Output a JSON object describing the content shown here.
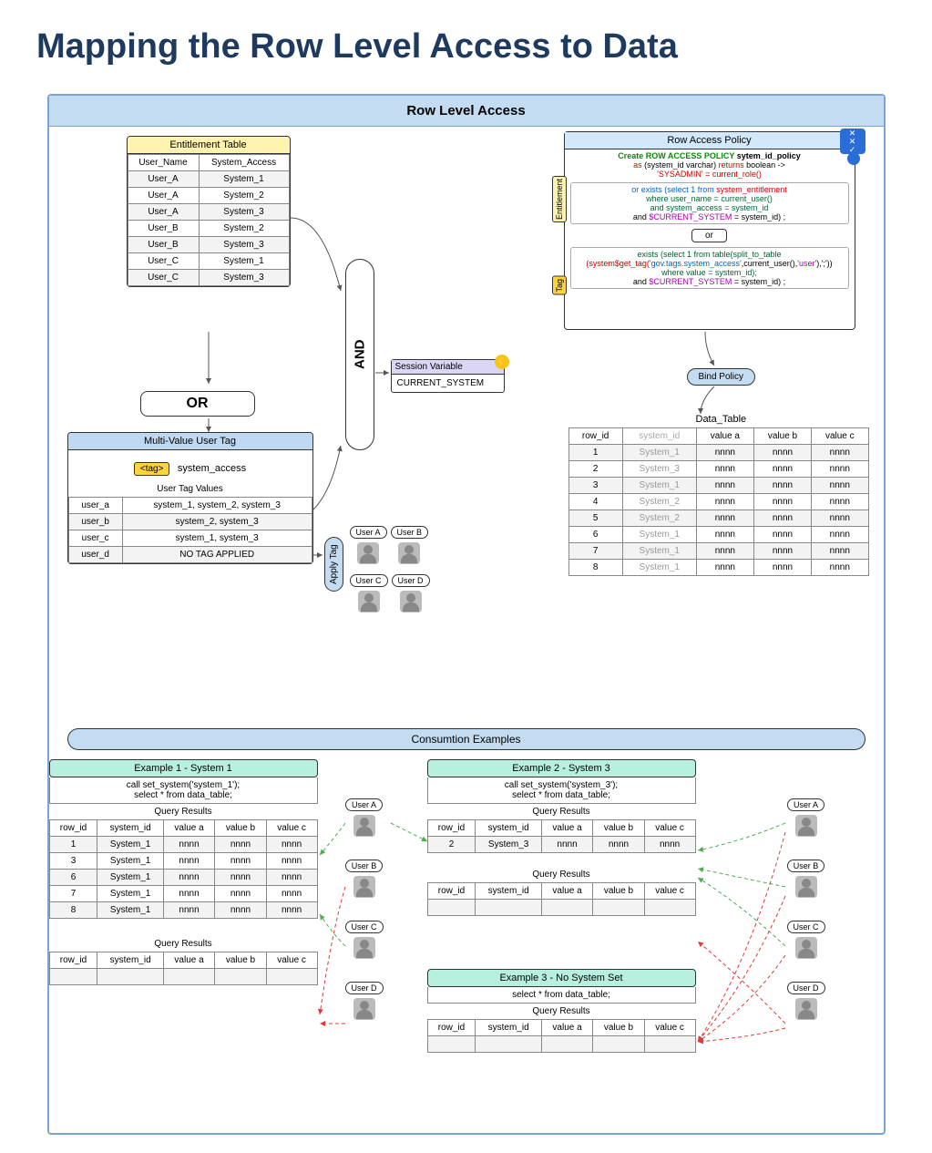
{
  "page_title": "Mapping the Row Level Access to Data",
  "frame_title": "Row Level Access",
  "entitlement": {
    "title": "Entitlement Table",
    "cols": [
      "User_Name",
      "System_Access"
    ],
    "rows": [
      [
        "User_A",
        "System_1"
      ],
      [
        "User_A",
        "System_2"
      ],
      [
        "User_A",
        "System_3"
      ],
      [
        "User_B",
        "System_2"
      ],
      [
        "User_B",
        "System_3"
      ],
      [
        "User_C",
        "System_1"
      ],
      [
        "User_C",
        "System_3"
      ]
    ]
  },
  "or_label": "OR",
  "and_label": "AND",
  "multi_tag": {
    "title": "Multi-Value User Tag",
    "chip": "<tag>",
    "chip_value": "system_access",
    "values_title": "User Tag Values",
    "rows": [
      [
        "user_a",
        "system_1, system_2, system_3"
      ],
      [
        "user_b",
        "system_2, system_3"
      ],
      [
        "user_c",
        "system_1, system_3"
      ],
      [
        "user_d",
        "NO TAG APPLIED"
      ]
    ]
  },
  "session": {
    "title": "Session Variable",
    "value": "CURRENT_SYSTEM"
  },
  "apply_tag": "Apply Tag",
  "users": [
    "User A",
    "User B",
    "User C",
    "User D"
  ],
  "policy": {
    "title": "Row Access Policy",
    "line1a": "Create ROW ACCESS POLICY ",
    "line1b": "sytem_id_policy",
    "line2a": "as ",
    "line2b": "(system_id varchar) ",
    "line2c": "returns ",
    "line2d": "boolean ->",
    "line3": "'SYSADMIN' = current_role()",
    "ent1a": "or exists (select 1 from ",
    "ent1b": "system_entitlement",
    "ent2": "where user_name = current_user()",
    "ent3": "and system_access = system_id",
    "ent4a": "and ",
    "ent4b": "$CURRENT_SYSTEM",
    "ent4c": " = system_id) ;",
    "or_mini": "or",
    "tag1a": "exists (select 1 from table(split_to_table",
    "tag2a": "(system$get_tag(",
    "tag2b": "'gov.tags.system_access'",
    "tag2c": ",current_user(),",
    "tag2d": "'user'",
    "tag2e": "),';'))",
    "tag3": "where value = system_id);",
    "tag4a": "and ",
    "tag4b": "$CURRENT_SYSTEM",
    "tag4c": " = system_id) ;",
    "ent_label": "Entitlement",
    "tag_label": "Tag"
  },
  "bind_label": "Bind Policy",
  "data_table": {
    "title": "Data_Table",
    "cols": [
      "row_id",
      "system_id",
      "value a",
      "value b",
      "value c"
    ],
    "rows": [
      [
        "1",
        "System_1",
        "nnnn",
        "nnnn",
        "nnnn"
      ],
      [
        "2",
        "System_3",
        "nnnn",
        "nnnn",
        "nnnn"
      ],
      [
        "3",
        "System_1",
        "nnnn",
        "nnnn",
        "nnnn"
      ],
      [
        "4",
        "System_2",
        "nnnn",
        "nnnn",
        "nnnn"
      ],
      [
        "5",
        "System_2",
        "nnnn",
        "nnnn",
        "nnnn"
      ],
      [
        "6",
        "System_1",
        "nnnn",
        "nnnn",
        "nnnn"
      ],
      [
        "7",
        "System_1",
        "nnnn",
        "nnnn",
        "nnnn"
      ],
      [
        "8",
        "System_1",
        "nnnn",
        "nnnn",
        "nnnn"
      ]
    ]
  },
  "consumption": "Consumtion Examples",
  "ex1": {
    "title": "Example 1 - System 1",
    "call": "call set_system('system_1');\nselect * from data_table;",
    "qr": "Query Results",
    "cols": [
      "row_id",
      "system_id",
      "value a",
      "value b",
      "value c"
    ],
    "rows": [
      [
        "1",
        "System_1",
        "nnnn",
        "nnnn",
        "nnnn"
      ],
      [
        "3",
        "System_1",
        "nnnn",
        "nnnn",
        "nnnn"
      ],
      [
        "6",
        "System_1",
        "nnnn",
        "nnnn",
        "nnnn"
      ],
      [
        "7",
        "System_1",
        "nnnn",
        "nnnn",
        "nnnn"
      ],
      [
        "8",
        "System_1",
        "nnnn",
        "nnnn",
        "nnnn"
      ]
    ],
    "qr2": "Query Results",
    "empty_cols": [
      "row_id",
      "system_id",
      "value a",
      "value b",
      "value c"
    ]
  },
  "ex2": {
    "title": "Example 2 - System 3",
    "call": "call set_system('system_3');\nselect * from data_table;",
    "qr": "Query Results",
    "cols": [
      "row_id",
      "system_id",
      "value a",
      "value b",
      "value c"
    ],
    "rows": [
      [
        "2",
        "System_3",
        "nnnn",
        "nnnn",
        "nnnn"
      ]
    ],
    "qr2": "Query Results",
    "empty_cols": [
      "row_id",
      "system_id",
      "value a",
      "value b",
      "value c"
    ]
  },
  "ex3": {
    "title": "Example 3 - No System Set",
    "call": "select * from data_table;",
    "qr": "Query Results",
    "cols": [
      "row_id",
      "system_id",
      "value a",
      "value b",
      "value c"
    ]
  }
}
